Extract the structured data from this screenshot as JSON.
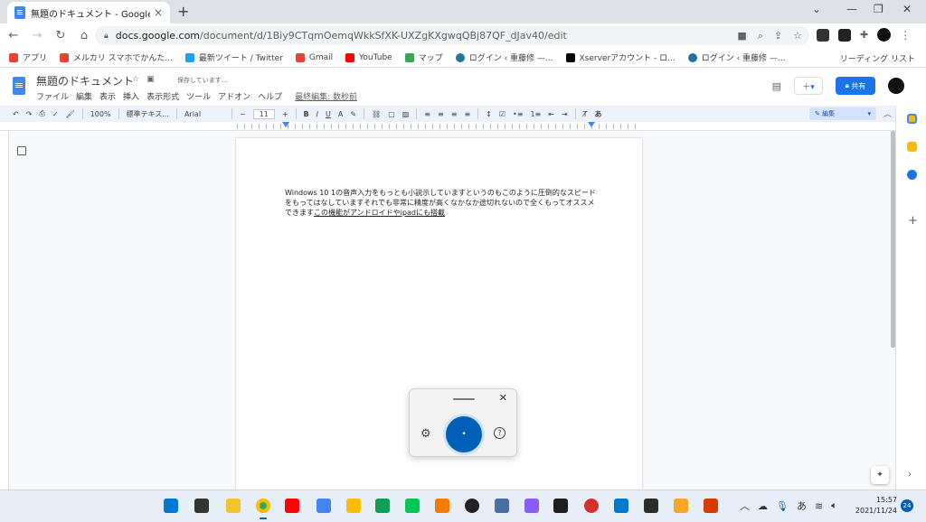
{
  "browser": {
    "tab_title": "無題のドキュメント - Google ドキュメ",
    "tab_close": "×",
    "new_tab": "+",
    "url_host": "docs.google.com",
    "url_path": "/document/d/1Biy9CTqmOemqWkkSfXK-UXZgKXgwqQBj87QF_dJav40/edit",
    "window_controls": [
      "⌄",
      "—",
      "❐",
      "✕"
    ]
  },
  "bookmarks": [
    {
      "label": "アプリ",
      "color": "#ea4335"
    },
    {
      "label": "メルカリ スマホでかんた...",
      "color": "#ea4335"
    },
    {
      "label": "最新ツイート / Twitter",
      "color": "#1da1f2"
    },
    {
      "label": "Gmail",
      "color": "#ea4335"
    },
    {
      "label": "YouTube",
      "color": "#ff0000"
    },
    {
      "label": "マップ",
      "color": "#34a853"
    },
    {
      "label": "ログイン ‹ 重藤修 —...",
      "color": "#21759b"
    },
    {
      "label": "Xserverアカウント - ロ...",
      "color": "#000000"
    },
    {
      "label": "ログイン ‹ 重藤修 —...",
      "color": "#21759b"
    }
  ],
  "reading_list": "リーディング リスト",
  "docs": {
    "title": "無題のドキュメント",
    "saving": "保存しています...",
    "menus": [
      "ファイル",
      "編集",
      "表示",
      "挿入",
      "表示形式",
      "ツール",
      "アドオン",
      "ヘルプ"
    ],
    "last_edit": "最終編集: 数秒前",
    "share": "共有",
    "toolbar": {
      "zoom": "100%",
      "style": "標準テキス...",
      "font": "Arial",
      "font_size": "11",
      "mode": "編集"
    },
    "body_text": "Windows 10 1の音声入力をもっとも小説示していますというのもこのように圧倒的なスピードをもってはなしていますそれでも非常に精度が高くなかなか途切れないので全くもってオススメできます",
    "body_underlined": "この機能がアンドロイドやipadにも搭載"
  },
  "voice_typing": {
    "close": "✕",
    "help": "?"
  },
  "taskbar": {
    "time": "15:57",
    "date": "2021/11/24",
    "notifications": "24",
    "ime": "あ"
  }
}
